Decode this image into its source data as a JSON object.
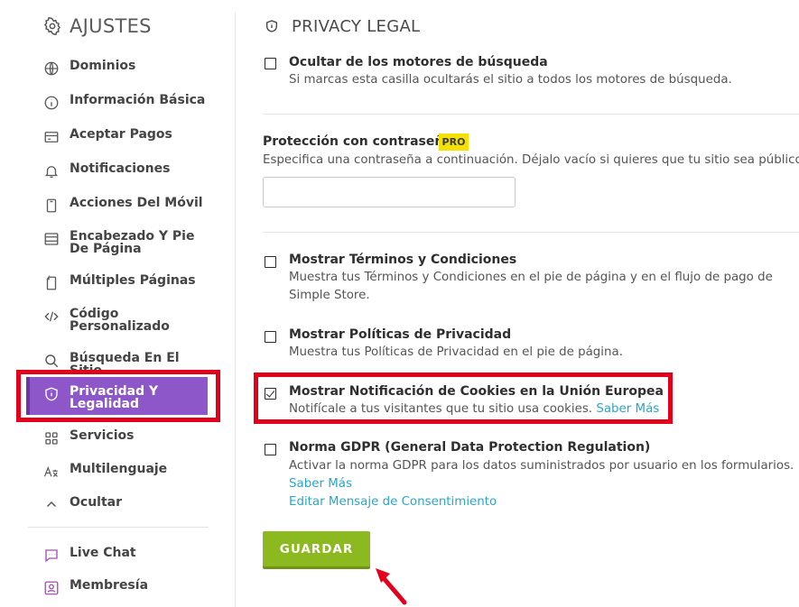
{
  "sidebar": {
    "title": "AJUSTES",
    "items": [
      {
        "label": "Dominios",
        "icon": "globe-icon"
      },
      {
        "label": "Información Básica",
        "icon": "info-icon"
      },
      {
        "label": "Aceptar Pagos",
        "icon": "credit-card-icon"
      },
      {
        "label": "Notificaciones",
        "icon": "bell-icon"
      },
      {
        "label": "Acciones Del Móvil",
        "icon": "mobile-icon"
      },
      {
        "label_line1": "Encabezado Y Pie",
        "label_line2": "De Página",
        "icon": "header-footer-icon"
      },
      {
        "label": "Múltiples Páginas",
        "icon": "pages-icon"
      },
      {
        "label_line1": "Código",
        "label_line2": "Personalizado",
        "icon": "code-icon"
      },
      {
        "label": "Búsqueda En El Sitio",
        "icon": "search-icon"
      },
      {
        "label_line1": "Privacidad Y",
        "label_line2": "Legalidad",
        "icon": "shield-icon",
        "active": true
      },
      {
        "label": "Servicios",
        "icon": "grid-icon"
      },
      {
        "label": "Multilenguaje",
        "icon": "language-icon"
      },
      {
        "label": "Ocultar",
        "icon": "chevron-up-icon"
      }
    ],
    "extra_items": [
      {
        "label": "Live Chat",
        "icon": "chat-icon"
      },
      {
        "label": "Membresía",
        "icon": "membership-icon"
      }
    ]
  },
  "main": {
    "title": "PRIVACY LEGAL",
    "hide_search": {
      "label": "Ocultar de los motores de búsqueda",
      "desc": "Si marcas esta casilla ocultarás el sitio a todos los motores de búsqueda.",
      "checked": false
    },
    "password": {
      "label": "Protección con contraseña",
      "badge": "PRO",
      "desc": "Especifica una contraseña a continuación. Déjalo vacío si quieres que tu sitio sea público.",
      "value": "",
      "placeholder": ""
    },
    "terms": {
      "label": "Mostrar Términos y Condiciones",
      "desc_line1": "Muestra tus Términos y Condiciones en el pie de página y en el flujo de pago de",
      "desc_line2": "Simple Store.",
      "checked": false
    },
    "privacy": {
      "label": "Mostrar Políticas de Privacidad",
      "desc": "Muestra tus Políticas de Privacidad en el pie de página.",
      "checked": false
    },
    "cookies": {
      "label": "Mostrar Notificación de Cookies en la Unión Europea",
      "desc": "Notifícale a tus visitantes que tu sitio usa cookies.",
      "link": "Saber Más",
      "checked": true
    },
    "gdpr": {
      "label": "Norma GDPR (General Data Protection Regulation)",
      "desc": "Activar la norma GDPR para los datos suministrados por usuario en los formularios.",
      "link1": "Saber Más",
      "link2": "Editar Mensaje de Consentimiento",
      "checked": false
    },
    "save_label": "GUARDAR"
  },
  "colors": {
    "active_nav": "#8e57c9",
    "save_button": "#8cb820",
    "link": "#2aa5c8",
    "highlight": "#e3001b",
    "pro_badge": "#f5e100"
  }
}
